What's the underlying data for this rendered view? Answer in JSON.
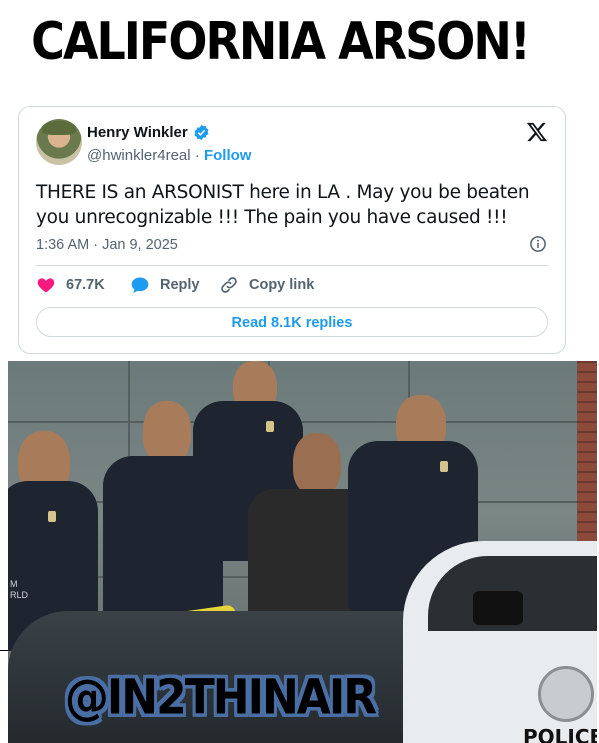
{
  "headline": "CALIFORNIA ARSON!",
  "tweet": {
    "author_name": "Henry Winkler",
    "handle": "@hwinkler4real",
    "separator": " · ",
    "follow_label": "Follow",
    "text": "THERE IS an ARSONIST here in LA . May you be beaten you unrecognizable !!! The pain you have caused !!!",
    "timestamp": "1:36 AM · Jan 9, 2025",
    "likes": "67.7K",
    "reply_label": "Reply",
    "copy_label": "Copy link",
    "read_replies_label": "Read 8.1K replies"
  },
  "photo": {
    "police_text": "POLICE",
    "jacket_text_1": "M",
    "jacket_text_2": "RLD"
  },
  "watermark": "@IN2THINAIR",
  "colors": {
    "accent": "#1d9bf0",
    "like": "#f91880",
    "text": "#0f1419",
    "muted": "#536471"
  },
  "icons": [
    "verified-icon",
    "x-logo-icon",
    "info-icon",
    "heart-icon",
    "reply-bubble-icon",
    "link-icon"
  ]
}
